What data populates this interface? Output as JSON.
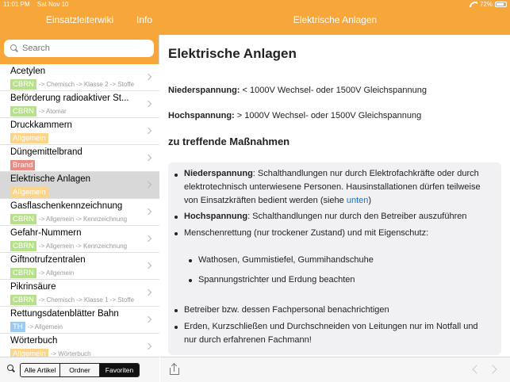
{
  "status": {
    "time": "11:01 PM",
    "date": "Sat Nov 10",
    "battery": "72%"
  },
  "left_nav": {
    "title": "Einsatzleiterwiki",
    "info_label": "Info"
  },
  "search": {
    "placeholder": "Search"
  },
  "items": [
    {
      "title": "Acetylen",
      "badge": "CBRN",
      "badge_type": "cbrn",
      "path": "-> Chemisch -> Klasse 2 -> Stoffe"
    },
    {
      "title": "Beförderung radioaktiver St...",
      "badge": "CBRN",
      "badge_type": "cbrn",
      "path": "-> Atomar"
    },
    {
      "title": "Druckkammern",
      "badge": "Allgemein",
      "badge_type": "allgemein",
      "path": ""
    },
    {
      "title": "Düngemittelbrand",
      "badge": "Brand",
      "badge_type": "brand",
      "path": ""
    },
    {
      "title": "Elektrische Anlagen",
      "badge": "Allgemein",
      "badge_type": "allgemein",
      "path": "",
      "selected": true
    },
    {
      "title": "Gasflaschenkennzeichnung",
      "badge": "CBRN",
      "badge_type": "cbrn",
      "path": "-> Allgemein -> Kennzeichnung"
    },
    {
      "title": "Gefahr-Nummern",
      "badge": "CBRN",
      "badge_type": "cbrn",
      "path": "-> Allgemein -> Kennzeichnung"
    },
    {
      "title": "Giftnotrufzentralen",
      "badge": "CBRN",
      "badge_type": "cbrn",
      "path": "-> Allgemein"
    },
    {
      "title": "Pikrinsäure",
      "badge": "CBRN",
      "badge_type": "cbrn",
      "path": "-> Chemisch -> Klasse 1 -> Stoffe"
    },
    {
      "title": "Rettungsdatenblätter Bahn",
      "badge": "TH",
      "badge_type": "th",
      "path": "-> Allgemein"
    },
    {
      "title": "Wörterbuch",
      "badge": "Allgemein",
      "badge_type": "allgemein",
      "path": "-> Wörterbuch"
    }
  ],
  "segments": {
    "all": "Alle Artikel",
    "folders": "Ordner",
    "favorites": "Favoriten",
    "active": "favorites"
  },
  "detail": {
    "nav_title": "Elektrische Anlagen",
    "heading": "Elektrische Anlagen",
    "nieder_label": "Niederspannung:",
    "nieder_text": " < 1000V Wechsel- oder 1500V Gleichspannung",
    "hoch_label": "Hochspannung:",
    "hoch_text": " > 1000V Wechsel- oder 1500V Gleichspannung",
    "measures_heading": "zu treffende Maßnahmen",
    "b1_label": "Niederspannung",
    "b1_text_1": ": Schalthandlungen nur durch Elektrofachkräfte oder durch",
    "b1_text_2": "elektrotechnisch unterwiesene Personen. Hausinstallationen dürfen teilweise",
    "b1_text_3_pre": "von Einsatzkräften bedient werden (siehe ",
    "b1_link": "unten",
    "b1_text_3_post": ")",
    "b2_label": "Hochspannung",
    "b2_text": ": Schalthandlungen nur durch den Betreiber auszuführen",
    "b3_text": "Menschenrettung (nur trockener Zustand) und mit Eigenschutz:",
    "sub1": "Wathosen, Gummistiefel, Gummihandschuhe",
    "sub2": "Spannungstrichter und Erdung beachten",
    "b4_text": "Betreiber bzw. dessen Fachpersonal benachrichtigen",
    "b5_text_1": "Erden, Kurzschließen und Durchschneiden von Leitungen nur im Notfall und",
    "b5_text_2": "nur durch erfahrenen Fachmann!"
  }
}
